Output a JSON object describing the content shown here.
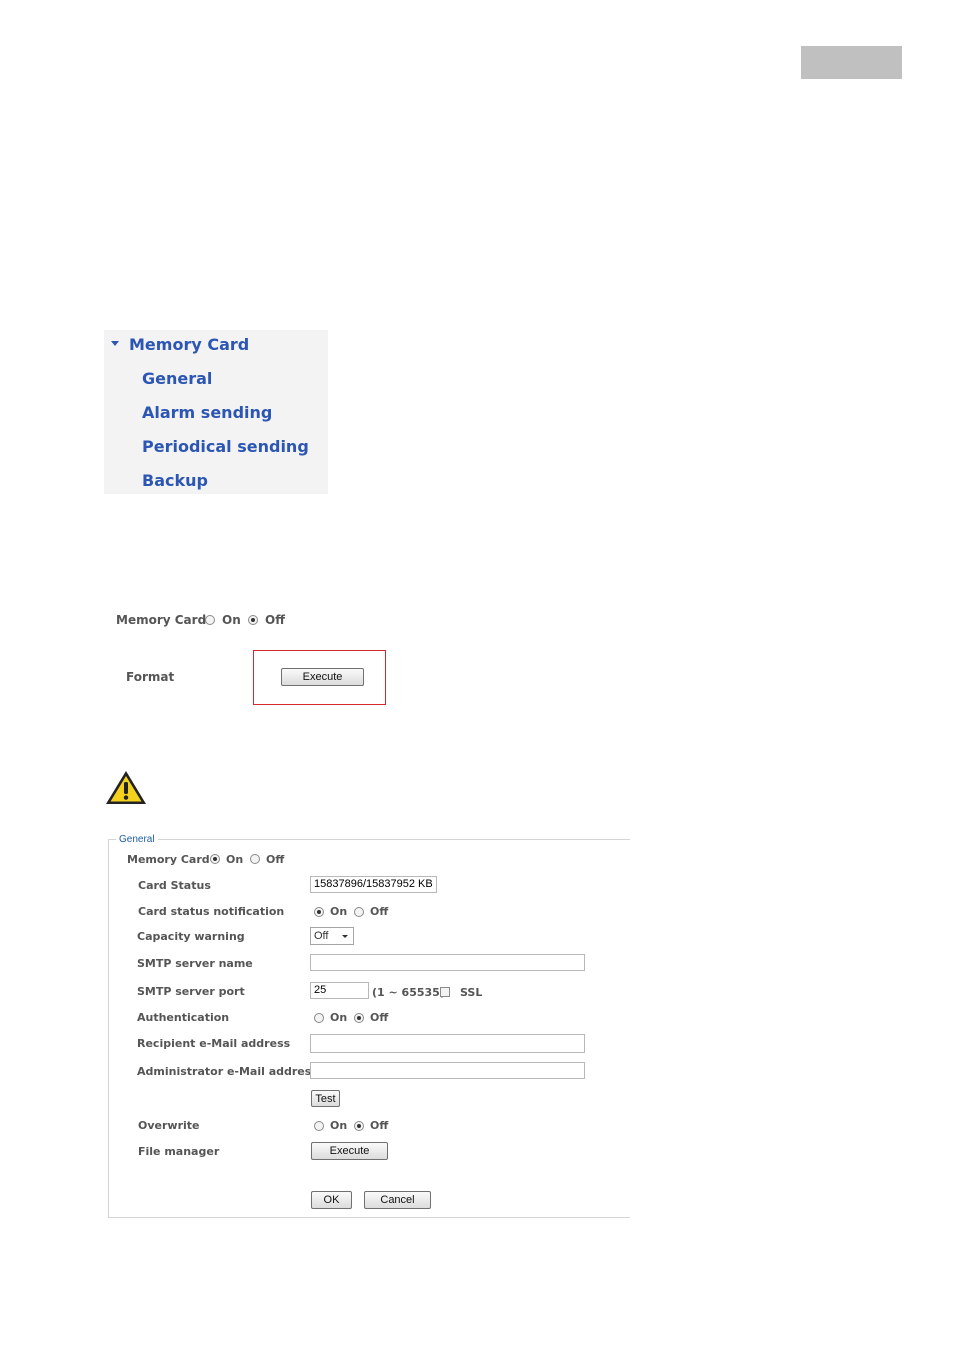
{
  "menu": {
    "section": "Memory Card",
    "items": [
      "General",
      "Alarm sending",
      "Periodical sending",
      "Backup"
    ]
  },
  "format_form": {
    "memory_card_label": "Memory Card",
    "on_label": "On",
    "off_label": "Off",
    "memory_card_selected": "Off",
    "format_label": "Format",
    "execute_label": "Execute"
  },
  "general": {
    "legend": "General",
    "memory_card_label": "Memory Card",
    "memory_card_selected": "On",
    "on_label": "On",
    "off_label": "Off",
    "card_status_label": "Card Status",
    "card_status_value": "15837896/15837952 KB",
    "card_status_notification_label": "Card status notification",
    "card_status_notification_selected": "On",
    "capacity_warning_label": "Capacity warning",
    "capacity_warning_value": "Off",
    "smtp_server_name_label": "SMTP server name",
    "smtp_server_name_value": "",
    "smtp_server_port_label": "SMTP server port",
    "smtp_server_port_value": "25",
    "port_range": "(1 ~ 65535)",
    "ssl_label": "SSL",
    "ssl_checked": false,
    "authentication_label": "Authentication",
    "authentication_selected": "Off",
    "recipient_label": "Recipient e-Mail address",
    "recipient_value": "",
    "administrator_label": "Administrator e-Mail address",
    "administrator_value": "",
    "test_label": "Test",
    "overwrite_label": "Overwrite",
    "overwrite_selected": "Off",
    "file_manager_label": "File manager",
    "execute_label": "Execute",
    "ok_label": "OK",
    "cancel_label": "Cancel"
  },
  "colors": {
    "menu_link": "#2c56b3",
    "highlight_border": "#d3282e",
    "legend": "#1d5fa8",
    "warning_yellow": "#f4d11c"
  },
  "icons": {
    "menu_caret": "caret-down-icon",
    "warning": "warning-triangle-icon"
  }
}
